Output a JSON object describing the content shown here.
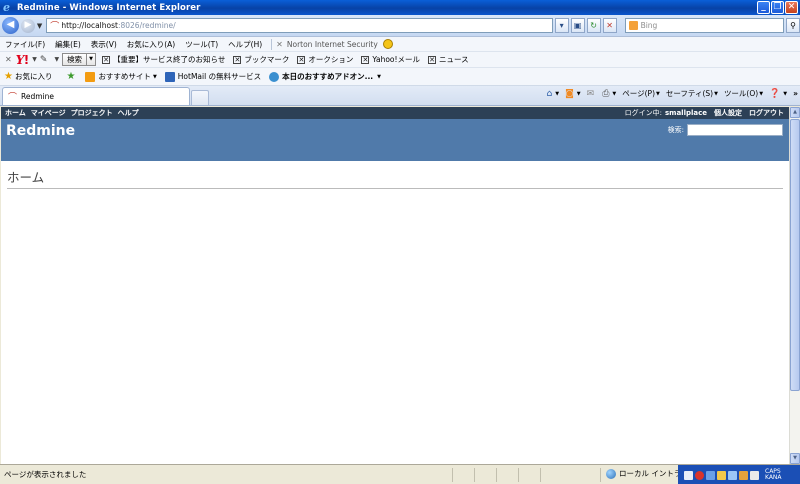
{
  "window": {
    "title": "Redmine - Windows Internet Explorer"
  },
  "address_bar": {
    "url_host": "http://localhost",
    "url_rest": ":8026/redmine/",
    "search_placeholder": "Bing"
  },
  "menu": {
    "items": [
      "ファイル(F)",
      "編集(E)",
      "表示(V)",
      "お気に入り(A)",
      "ツール(T)",
      "ヘルプ(H)"
    ],
    "norton": "Norton Internet Security"
  },
  "yahoo_toolbar": {
    "search_label": "検索",
    "links": [
      "【重要】サービス終了のお知らせ",
      "ブックマーク",
      "オークション",
      "Yahoo!メール",
      "ニュース"
    ]
  },
  "favorites_bar": {
    "favorites_label": "お気に入り",
    "items": [
      "おすすめサイト",
      "HotMail の無料サービス",
      "本日のおすすめアドオン..."
    ]
  },
  "tabs": [
    {
      "label": "Redmine"
    }
  ],
  "command_bar": {
    "page": "ページ(P)",
    "safety": "セーフティ(S)",
    "tools": "ツール(O)"
  },
  "redmine": {
    "top_menu": [
      "ホーム",
      "マイページ",
      "プロジェクト",
      "ヘルプ"
    ],
    "logged_in_as_label": "ログイン中:",
    "username": "smallplace",
    "my_account": "個人設定",
    "logout": "ログアウト",
    "site_title": "Redmine",
    "search_label": "検索:",
    "page_heading": "ホーム"
  },
  "status_bar": {
    "status_text": "ページが表示されました",
    "zone": "ローカル イントラネット",
    "ime_line1": "CAPS",
    "ime_line2": "KANA"
  },
  "colors": {
    "redmine_top_menu": "#2c4056",
    "redmine_header": "#507aaa",
    "xp_titlebar": "#0842a6"
  }
}
